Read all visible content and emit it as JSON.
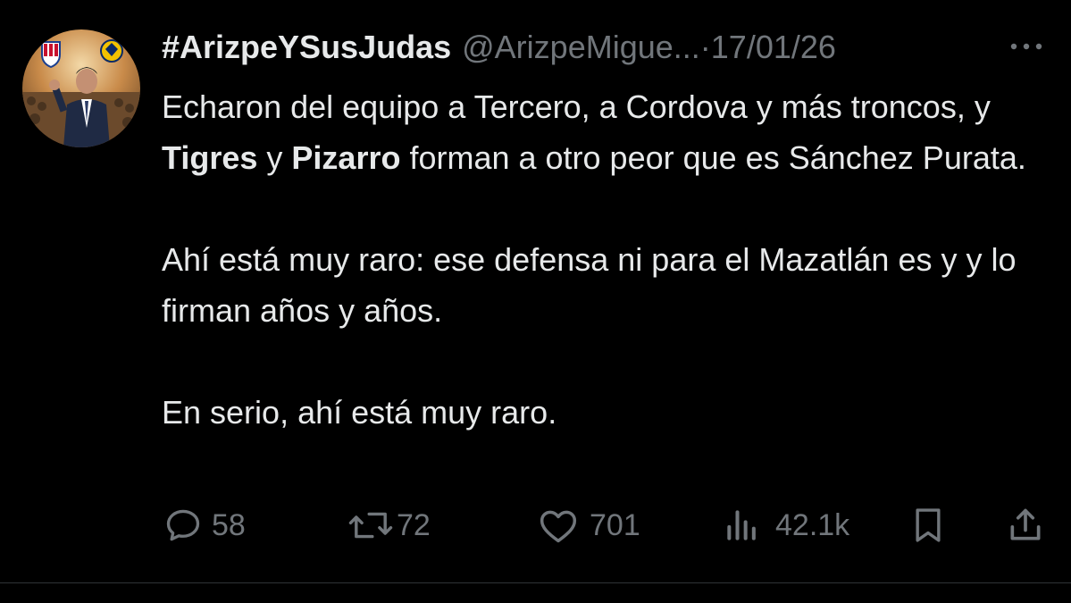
{
  "author": {
    "display_name": "#ArizpeYSusJudas",
    "handle": "@ArizpeMigue...",
    "separator": "·",
    "date": "17/01/26"
  },
  "content": {
    "p1_part1": "Echaron del equipo a Tercero, a Cordova y más troncos, y ",
    "p1_bold1": "Tigres",
    "p1_part2": " y ",
    "p1_bold2": "Pizarro",
    "p1_part3": " forman a otro peor que es Sánchez Purata.",
    "p2": "Ahí está muy raro: ese defensa ni para el Mazatlán es y y lo firman años y años.",
    "p3": "En serio, ahí está muy raro."
  },
  "actions": {
    "replies": "58",
    "reposts": "72",
    "likes": "701",
    "views": "42.1k"
  },
  "icons": [
    "avatar",
    "more-icon",
    "reply-icon",
    "repost-icon",
    "like-icon",
    "views-icon",
    "bookmark-icon",
    "share-icon"
  ],
  "colors": {
    "background": "#000000",
    "text": "#e7e9ea",
    "secondary": "#71767b",
    "divider": "#2f3336"
  }
}
